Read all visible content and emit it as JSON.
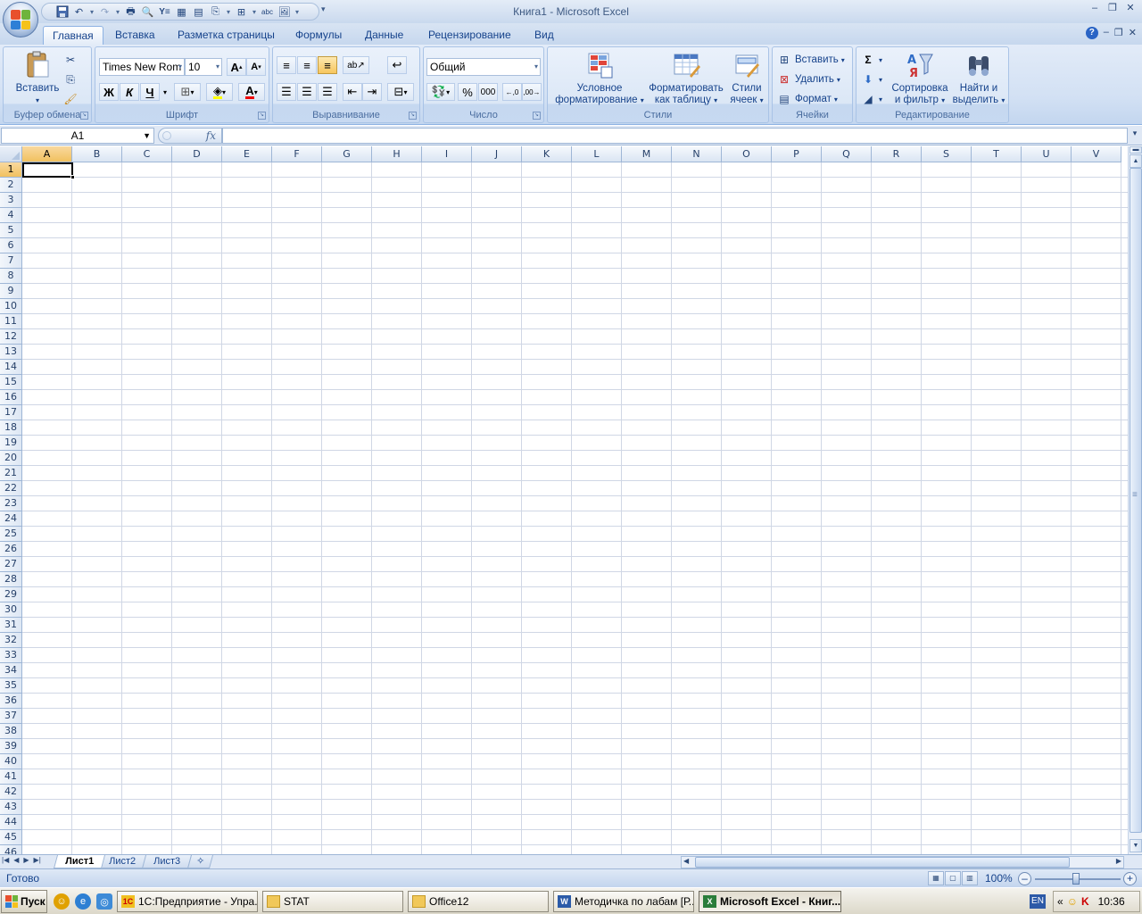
{
  "window": {
    "title": "Книга1  -  Microsoft Excel",
    "controls": [
      "–",
      "❐",
      "✕"
    ]
  },
  "colors": {
    "accent": "#15428b",
    "ribbon": "#dbe7f6",
    "selected_header": "#f1c15f",
    "grid": "#d0d7e5"
  },
  "ribbon": {
    "tabs": [
      {
        "label": "Главная",
        "active": true
      },
      {
        "label": "Вставка"
      },
      {
        "label": "Разметка страницы"
      },
      {
        "label": "Формулы"
      },
      {
        "label": "Данные"
      },
      {
        "label": "Рецензирование"
      },
      {
        "label": "Вид"
      }
    ],
    "clipboard": {
      "label": "Буфер обмена",
      "paste": "Вставить"
    },
    "font": {
      "label": "Шрифт",
      "name": "Times New Rom",
      "size": "10",
      "bold": "Ж",
      "italic": "К",
      "underline": "Ч"
    },
    "alignment": {
      "label": "Выравнивание"
    },
    "number": {
      "label": "Число",
      "format": "Общий",
      "percent": "%",
      "thousands": "000"
    },
    "styles": {
      "label": "Стили",
      "conditional_1": "Условное",
      "conditional_2": "форматирование",
      "as_table_1": "Форматировать",
      "as_table_2": "как таблицу",
      "cell_styles_1": "Стили",
      "cell_styles_2": "ячеек"
    },
    "cells": {
      "label": "Ячейки",
      "insert": "Вставить",
      "delete": "Удалить",
      "format": "Формат"
    },
    "editing": {
      "label": "Редактирование",
      "sort_1": "Сортировка",
      "sort_2": "и фильтр",
      "find_1": "Найти и",
      "find_2": "выделить"
    }
  },
  "formula_bar": {
    "name_box": "A1",
    "fx": "fx",
    "value": ""
  },
  "sheet": {
    "columns": [
      "A",
      "B",
      "C",
      "D",
      "E",
      "F",
      "G",
      "H",
      "I",
      "J",
      "K",
      "L",
      "M",
      "N",
      "O",
      "P",
      "Q",
      "R",
      "S",
      "T",
      "U",
      "V"
    ],
    "rows": [
      "1",
      "2",
      "3",
      "4",
      "5",
      "6",
      "7",
      "8",
      "9",
      "10",
      "11",
      "12",
      "13",
      "14",
      "15",
      "16",
      "17",
      "18",
      "19",
      "20",
      "21",
      "22",
      "23",
      "24",
      "25",
      "26",
      "27",
      "28",
      "29",
      "30",
      "31",
      "32",
      "33",
      "34",
      "35",
      "36",
      "37",
      "38",
      "39",
      "40",
      "41",
      "42",
      "43",
      "44",
      "45",
      "46"
    ],
    "active_cell": "A1",
    "tabs": [
      "Лист1",
      "Лист2",
      "Лист3"
    ]
  },
  "status": {
    "text": "Готово",
    "zoom": "100%"
  },
  "taskbar": {
    "start": "Пуск",
    "tasks": [
      {
        "label": "1С:Предприятие - Упра..."
      },
      {
        "label": "STAT"
      },
      {
        "label": "Office12"
      },
      {
        "label": "Методичка по лабам [Р..."
      },
      {
        "label": "Microsoft Excel - Книг...",
        "active": true
      }
    ],
    "lang": "EN",
    "clock": "10:36"
  }
}
